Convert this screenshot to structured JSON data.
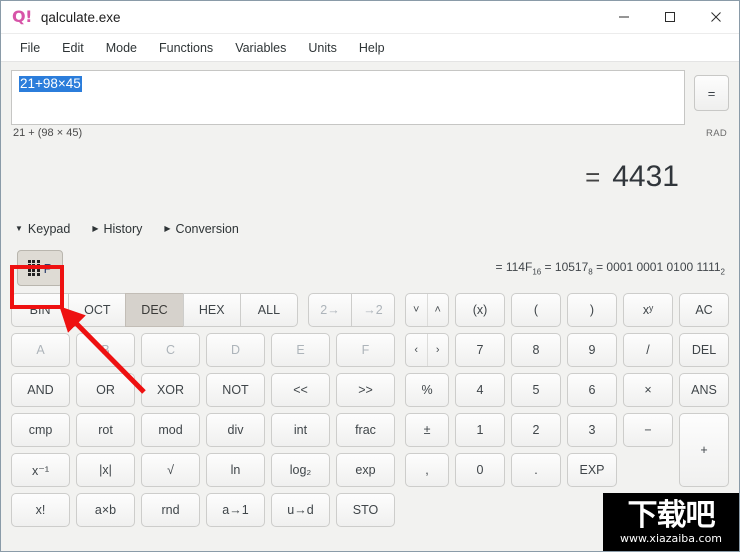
{
  "window": {
    "logo": "Q!",
    "title": "qalculate.exe",
    "controls": {
      "minimize": "minimize-icon",
      "maximize": "maximize-icon",
      "close": "close-icon"
    }
  },
  "menubar": {
    "items": [
      "File",
      "Edit",
      "Mode",
      "Functions",
      "Variables",
      "Units",
      "Help"
    ]
  },
  "expression": {
    "value": "21+98×45",
    "parsed": "21 + (98 × 45)",
    "angle_unit": "RAD",
    "equals_button": "=",
    "selected": true
  },
  "result": {
    "equals_sign": "=",
    "value": "4431"
  },
  "tabs": [
    {
      "label": "Keypad",
      "marker": "▼",
      "expanded": true
    },
    {
      "label": "History",
      "marker": "▶",
      "expanded": false
    },
    {
      "label": "Conversion",
      "marker": "▶",
      "expanded": false
    }
  ],
  "keypad_toggle": {
    "icon": "keypad-grid-icon",
    "label": "P"
  },
  "base_conversion_line": {
    "hex": {
      "prefix": "= ",
      "value": "114F",
      "base": "16"
    },
    "oct": {
      "prefix": " = ",
      "value": "10517",
      "base": "8"
    },
    "bin": {
      "prefix": " = ",
      "value": "0001 0001 0100 1111",
      "base": "2"
    }
  },
  "left_keypad": {
    "base_row": {
      "bases": [
        "BIN",
        "OCT",
        "DEC",
        "HEX",
        "ALL"
      ],
      "selected": "DEC",
      "converters": [
        "2→",
        "→2"
      ]
    },
    "rows": [
      {
        "dim": true,
        "keys": [
          "A",
          "B",
          "C",
          "D",
          "E",
          "F"
        ]
      },
      {
        "dim": false,
        "keys": [
          "AND",
          "OR",
          "XOR",
          "NOT",
          "<<",
          ">>"
        ]
      },
      {
        "dim": false,
        "keys": [
          "cmp",
          "rot",
          "mod",
          "div",
          "int",
          "frac"
        ]
      },
      {
        "dim": false,
        "keys": [
          "x⁻¹",
          "|x|",
          "√",
          "ln",
          "log₂",
          "exp"
        ]
      },
      {
        "dim": false,
        "keys": [
          "x!",
          "a×b",
          "rnd",
          "a→1",
          "u→d",
          "STO"
        ]
      }
    ]
  },
  "right_keypad": {
    "nav": [
      {
        "name": "down-up-nav",
        "left": "˅",
        "right": "˄"
      },
      {
        "name": "left-right-nav",
        "left": "‹",
        "right": "›"
      }
    ],
    "nav_extra": [
      "%",
      "±",
      ","
    ],
    "rows": [
      [
        "(x)",
        "(",
        ")",
        "xʸ",
        "AC"
      ],
      [
        "7",
        "8",
        "9",
        "/",
        "DEL"
      ],
      [
        "4",
        "5",
        "6",
        "×",
        "ANS"
      ],
      [
        "1",
        "2",
        "3",
        "−",
        "+"
      ],
      [
        "0",
        ".",
        "EXP"
      ]
    ]
  },
  "annotations": {
    "highlight_color": "#ee1111",
    "target": "keypad-toggle-button"
  },
  "watermark": {
    "text_cn": "下载吧",
    "url": "www.xiazaiba.com"
  }
}
